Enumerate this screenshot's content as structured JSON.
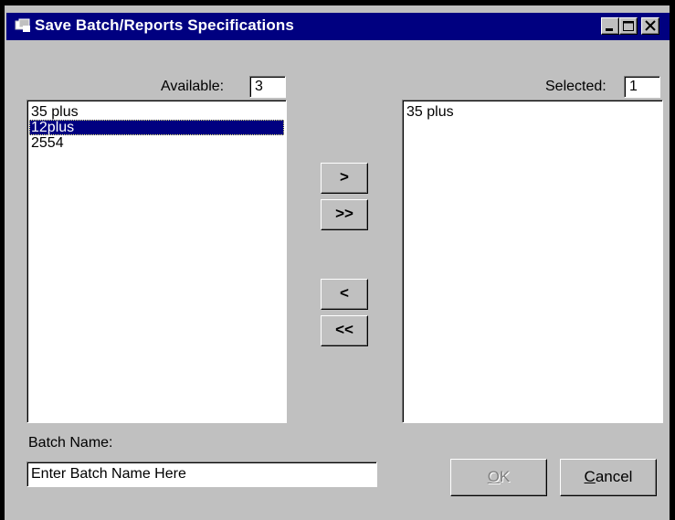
{
  "window": {
    "title": "Save Batch/Reports Specifications",
    "controls": [
      "minimize-icon",
      "maximize-icon",
      "close-icon"
    ]
  },
  "available": {
    "label": "Available:",
    "count": "3",
    "items": [
      "35 plus",
      "12plus",
      "2554"
    ],
    "selected_item": "12plus"
  },
  "selected": {
    "label": "Selected:",
    "count": "1",
    "items": [
      "35 plus"
    ]
  },
  "transfer": {
    "add_one": ">",
    "add_all": ">>",
    "remove_one": "<",
    "remove_all": "<<"
  },
  "batch": {
    "label": "Batch Name:",
    "value": "Enter Batch Name Here"
  },
  "buttons": {
    "ok_mnemonic": "O",
    "ok_rest": "K",
    "ok_enabled": false,
    "cancel_mnemonic": "C",
    "cancel_rest": "ancel"
  },
  "colors": {
    "titlebar": "#000080",
    "face": "#c0c0c0",
    "selection": "#000080"
  }
}
